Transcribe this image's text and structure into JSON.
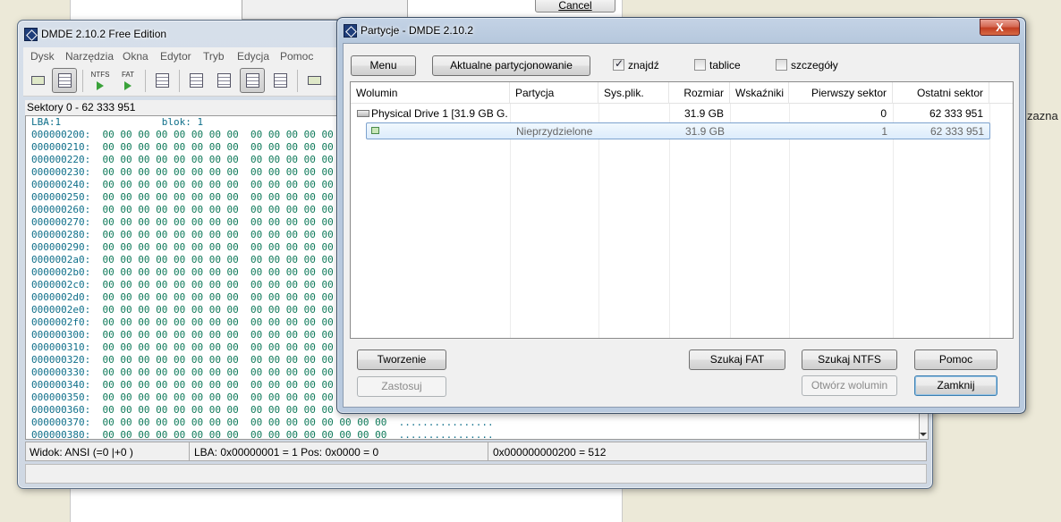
{
  "background": {
    "cancel_label": "Cancel",
    "side_text": "zazna"
  },
  "main_window": {
    "title": "DMDE 2.10.2 Free Edition",
    "menu": [
      "Dysk",
      "Narzędzia",
      "Okna",
      "Edytor",
      "Tryb",
      "Edycja",
      "Pomoc"
    ],
    "toolbar": {
      "ntfs_label": "NTFS",
      "fat_label": "FAT"
    },
    "sectors_header": "Sektory 0 - 62 333 951",
    "hex": {
      "lba_label": "LBA:1",
      "block_label": "blok: 1",
      "rows": [
        {
          "addr": "000000200:",
          "bytes": "00 00 00 00 00 00 00 00  00 00 00 00 00 00 00 00",
          "ascii": "................"
        },
        {
          "addr": "000000210:",
          "bytes": "00 00 00 00 00 00 00 00  00 00 00 00 00 00 00 00",
          "ascii": "................"
        },
        {
          "addr": "000000220:",
          "bytes": "00 00 00 00 00 00 00 00  00 00 00 00 00 00 00 00",
          "ascii": "................"
        },
        {
          "addr": "000000230:",
          "bytes": "00 00 00 00 00 00 00 00  00 00 00 00 00 00 00 00",
          "ascii": "................"
        },
        {
          "addr": "000000240:",
          "bytes": "00 00 00 00 00 00 00 00  00 00 00 00 00 00 00 00",
          "ascii": "................"
        },
        {
          "addr": "000000250:",
          "bytes": "00 00 00 00 00 00 00 00  00 00 00 00 00 00 00 00",
          "ascii": "................"
        },
        {
          "addr": "000000260:",
          "bytes": "00 00 00 00 00 00 00 00  00 00 00 00 00 00 00 00",
          "ascii": "................"
        },
        {
          "addr": "000000270:",
          "bytes": "00 00 00 00 00 00 00 00  00 00 00 00 00 00 00 00",
          "ascii": "................"
        },
        {
          "addr": "000000280:",
          "bytes": "00 00 00 00 00 00 00 00  00 00 00 00 00 00 00 00",
          "ascii": "................"
        },
        {
          "addr": "000000290:",
          "bytes": "00 00 00 00 00 00 00 00  00 00 00 00 00 00 00 00",
          "ascii": "................"
        },
        {
          "addr": "0000002a0:",
          "bytes": "00 00 00 00 00 00 00 00  00 00 00 00 00 00 00 00",
          "ascii": "................"
        },
        {
          "addr": "0000002b0:",
          "bytes": "00 00 00 00 00 00 00 00  00 00 00 00 00 00 00 00",
          "ascii": "................"
        },
        {
          "addr": "0000002c0:",
          "bytes": "00 00 00 00 00 00 00 00  00 00 00 00 00 00 00 00",
          "ascii": "................"
        },
        {
          "addr": "0000002d0:",
          "bytes": "00 00 00 00 00 00 00 00  00 00 00 00 00 00 00 00",
          "ascii": "................"
        },
        {
          "addr": "0000002e0:",
          "bytes": "00 00 00 00 00 00 00 00  00 00 00 00 00 00 00 00",
          "ascii": "................"
        },
        {
          "addr": "0000002f0:",
          "bytes": "00 00 00 00 00 00 00 00  00 00 00 00 00 00 00 00",
          "ascii": "................"
        },
        {
          "addr": "000000300:",
          "bytes": "00 00 00 00 00 00 00 00  00 00 00 00 00 00 00 00",
          "ascii": "................"
        },
        {
          "addr": "000000310:",
          "bytes": "00 00 00 00 00 00 00 00  00 00 00 00 00 00 00 00",
          "ascii": "................"
        },
        {
          "addr": "000000320:",
          "bytes": "00 00 00 00 00 00 00 00  00 00 00 00 00 00 00 00",
          "ascii": "................"
        },
        {
          "addr": "000000330:",
          "bytes": "00 00 00 00 00 00 00 00  00 00 00 00 00 00 00 00",
          "ascii": "................"
        },
        {
          "addr": "000000340:",
          "bytes": "00 00 00 00 00 00 00 00  00 00 00 00 00 00 00 00",
          "ascii": "................"
        },
        {
          "addr": "000000350:",
          "bytes": "00 00 00 00 00 00 00 00  00 00 00 00 00 00 00 00",
          "ascii": "................"
        },
        {
          "addr": "000000360:",
          "bytes": "00 00 00 00 00 00 00 00  00 00 00 00 00 00 00 00",
          "ascii": "................"
        },
        {
          "addr": "000000370:",
          "bytes": "00 00 00 00 00 00 00 00  00 00 00 00 00 00 00 00",
          "ascii": "................"
        },
        {
          "addr": "000000380:",
          "bytes": "00 00 00 00 00 00 00 00  00 00 00 00 00 00 00 00",
          "ascii": "................"
        }
      ]
    },
    "status": {
      "view": "Widok: ANSI (=0  |+0  )",
      "lba_pos": "LBA: 0x00000001 = 1  Pos: 0x0000 = 0",
      "offset": "0x000000000200 = 512"
    }
  },
  "dialog": {
    "title": "Partycje - DMDE 2.10.2",
    "close_label": "X",
    "buttons": {
      "menu": "Menu",
      "current": "Aktualne partycjonowanie",
      "create": "Tworzenie",
      "apply": "Zastosuj",
      "search_fat": "Szukaj FAT",
      "search_ntfs": "Szukaj NTFS",
      "help": "Pomoc",
      "open_volume": "Otwórz wolumin",
      "close": "Zamknij"
    },
    "checkboxes": [
      {
        "label": "znajdź",
        "checked": true
      },
      {
        "label": "tablice",
        "checked": false
      },
      {
        "label": "szczegóły",
        "checked": false
      }
    ],
    "columns": [
      "Wolumin",
      "Partycja",
      "Sys.plik.",
      "Rozmiar",
      "Wskaźniki",
      "Pierwszy sektor",
      "Ostatni sektor"
    ],
    "rows": [
      {
        "volume": "Physical Drive 1 [31.9 GB G...",
        "partition": "",
        "fs": "",
        "size": "31.9 GB",
        "flags": "",
        "first": "0",
        "last": "62 333 951"
      },
      {
        "volume": "",
        "partition": "Nieprzydzielone",
        "fs": "",
        "size": "31.9 GB",
        "flags": "",
        "first": "1",
        "last": "62 333 951"
      }
    ]
  },
  "colors": {
    "hex_address": "#0f6f8a",
    "hex_bytes": "#0f7a5a",
    "close_button": "#c23e22",
    "selection": "#dcecfc"
  }
}
